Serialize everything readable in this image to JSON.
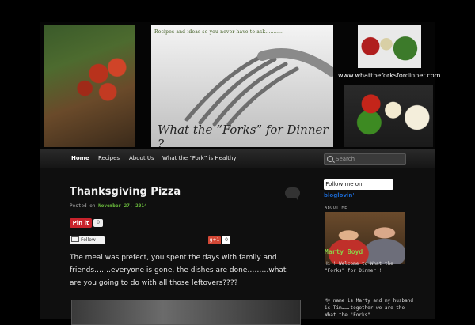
{
  "header": {
    "tagline": "Recipes and ideas so you never have to ask...........",
    "site_title": "What the “Forks” for Dinner ?",
    "url": "www.whattheforksfordinner.com"
  },
  "nav": {
    "items": [
      {
        "label": "Home",
        "active": true
      },
      {
        "label": "Recipes",
        "active": false
      },
      {
        "label": "About Us",
        "active": false
      },
      {
        "label": "What the “Fork” is Healthy",
        "active": false
      }
    ],
    "search_placeholder": "Search"
  },
  "post": {
    "title": "Thanksgiving Pizza",
    "posted_prefix": "Posted on",
    "date": "November 27, 2014",
    "pinit_label": "Pin it",
    "pin_count": "0",
    "follow_label": "Follow",
    "gplus_label": "g+1",
    "gplus_count": "0",
    "body": "The meal was prefect, you spent the days with family and friends…….everyone is gone, the dishes are done………what are you going to do with all those leftovers????"
  },
  "sidebar": {
    "bloglovin_prefix": "Follow me on",
    "bloglovin_brand": "bloglovin'",
    "about_title": "ABOUT ME",
    "name": "Marty Boyd",
    "intro": "Hi ! Welcome to What the \"Forks\" for Dinner !",
    "bio": "My name is Marty and my husband is Tim…….together we are the What the \"Forks\""
  },
  "colors": {
    "accent_green": "#6cbf3d",
    "pinit_red": "#c8232c",
    "name_green": "#8bd04a"
  }
}
